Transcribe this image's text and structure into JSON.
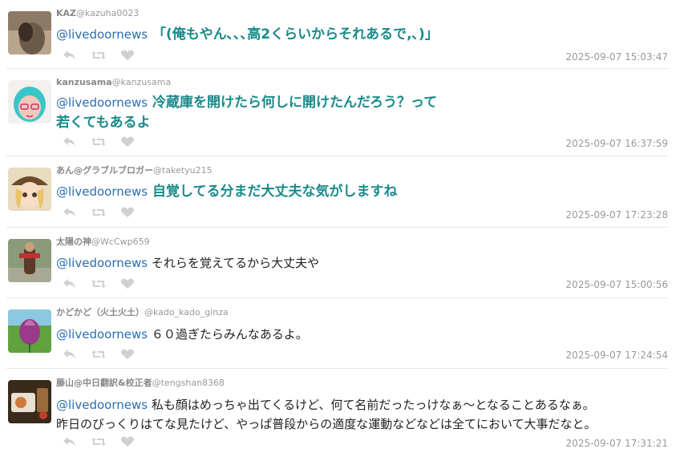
{
  "tweets": [
    {
      "display_name": "KAZ",
      "screen_name": "@kazuha0023",
      "mention": "@livedoornews",
      "text_lines": [
        "「(俺もやん､､､高2くらいからそれあるで,､)」"
      ],
      "timestamp": "2025-09-07 15:03:47",
      "big": true,
      "avatar_colors": [
        "#6a5a4a",
        "#b9a58d"
      ]
    },
    {
      "display_name": "kanzusama",
      "screen_name": "@kanzusama",
      "mention": "@livedoornews",
      "text_lines": [
        "冷蔵庫を開けたら何しに開けたんだろう？って",
        "若くてもあるよ"
      ],
      "timestamp": "2025-09-07 16:37:59",
      "big": true,
      "avatar_colors": [
        "#39c6c9",
        "#f4c8b9"
      ]
    },
    {
      "display_name": "あん@グラブルブロガー",
      "screen_name": "@taketyu215",
      "mention": "@livedoornews",
      "text_lines": [
        "自覚してる分まだ大丈夫な気がしますね"
      ],
      "timestamp": "2025-09-07 17:23:28",
      "big": true,
      "avatar_colors": [
        "#6b4b2a",
        "#e8c36a"
      ]
    },
    {
      "display_name": "太陽の神",
      "screen_name": "@WcCwp659",
      "mention": "@livedoornews",
      "text_lines": [
        "それらを覚えてるから大丈夫や"
      ],
      "timestamp": "2025-09-07 15:00:56",
      "big": false,
      "avatar_colors": [
        "#8a9a7a",
        "#5b3a2a"
      ]
    },
    {
      "display_name": "かどかど（火土火土）",
      "screen_name": "@kado_kado_ginza",
      "mention": "@livedoornews",
      "text_lines": [
        "６０過ぎたらみんなあるよ。"
      ],
      "timestamp": "2025-09-07 17:24:54",
      "big": false,
      "avatar_colors": [
        "#6fb34a",
        "#9b3a8a"
      ]
    },
    {
      "display_name": "藤山@中日翻訳&校正者",
      "screen_name": "@tengshan8368",
      "mention": "@livedoornews",
      "text_lines": [
        "私も顔はめっちゃ出てくるけど、何て名前だったっけなぁ～となることあるなぁ。",
        "昨日のびっくりはてな見たけど、やっぱ普段からの適度な運動などなどは全てにおいて大事だなと。"
      ],
      "timestamp": "2025-09-07 17:31:21",
      "big": false,
      "avatar_colors": [
        "#3a2a1a",
        "#d07a3a"
      ]
    }
  ],
  "icons": [
    "reply-icon",
    "retweet-icon",
    "like-icon"
  ],
  "colors": {
    "mention": "#2a6db4",
    "highlight": "#1a8a8a",
    "icon": "#d0d0d0",
    "muted": "#999999"
  }
}
